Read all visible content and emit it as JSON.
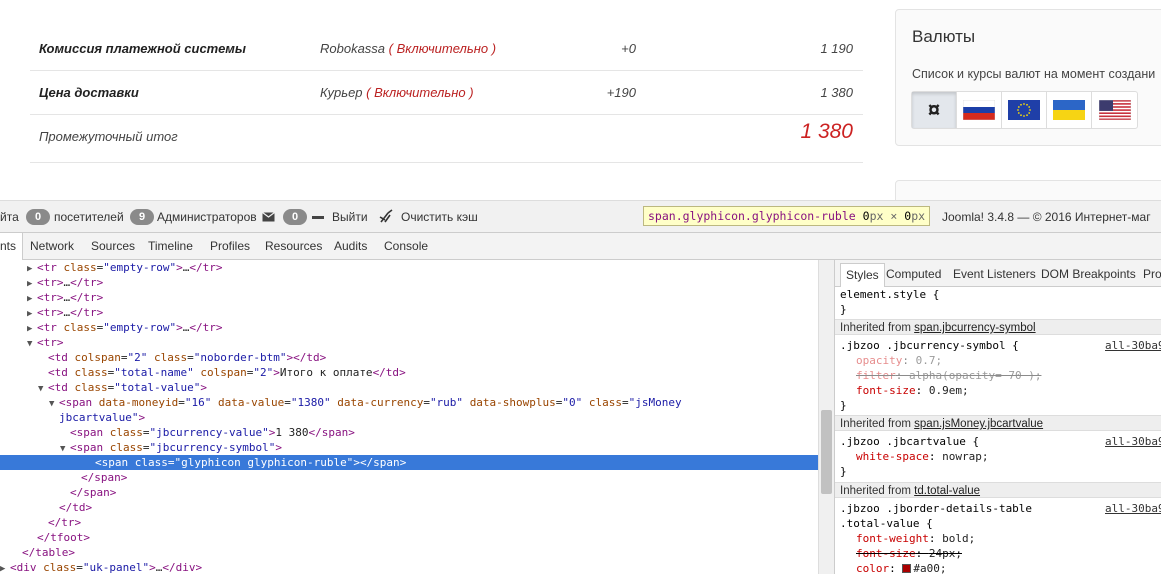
{
  "site": {
    "order_rows": [
      {
        "name": "Комиссия платежной системы",
        "method": "Robokassa",
        "included": "( Включительно )",
        "delta": "+0",
        "total": "1 190"
      },
      {
        "name": "Цена доставки",
        "method": "Курьер",
        "included": "( Включительно )",
        "delta": "+190",
        "total": "1 380"
      }
    ],
    "subtotal": {
      "label": "Промежуточный итог",
      "value": "1 380"
    },
    "currency_panel": {
      "title": "Валюты",
      "description": "Список и курсы валют на момент создани",
      "flags": [
        {
          "name": "generic-currency",
          "icon": "currency-sign-icon",
          "glyph": "¤",
          "active": true
        },
        {
          "name": "russia",
          "icon": "flag-ru-icon",
          "active": false
        },
        {
          "name": "eu",
          "icon": "flag-eu-icon",
          "active": false
        },
        {
          "name": "ukraine",
          "icon": "flag-ua-icon",
          "active": false
        },
        {
          "name": "usa",
          "icon": "flag-us-icon",
          "active": false
        }
      ]
    }
  },
  "admin_bar": {
    "cut_text": "йта",
    "visitors_count": "0",
    "visitors_label": "посетителей",
    "admins_count": "9",
    "admins_label": "Администраторов",
    "messages_count": "0",
    "logout_label": "Выйти",
    "clear_cache_label": "Очистить кэш",
    "version_text": "Joomla! 3.4.8 — © 2016 Интернет-маг"
  },
  "tooltip": {
    "selector": "span.glyphicon.glyphicon-ruble",
    "width": "0",
    "unit1": "px",
    "times": "×",
    "height": "0",
    "unit2": "px"
  },
  "devtools": {
    "tabs": [
      "nts",
      "Network",
      "Sources",
      "Timeline",
      "Profiles",
      "Resources",
      "Audits",
      "Console"
    ],
    "dom": [
      {
        "tri": "▶",
        "html": "<tr class=\"empty-row\">…</tr>"
      },
      {
        "tri": "▶",
        "html": "<tr>…</tr>"
      },
      {
        "tri": "▶",
        "html": "<tr>…</tr>"
      },
      {
        "tri": "▶",
        "html": "<tr>…</tr>"
      },
      {
        "tri": "▶",
        "html": "<tr class=\"empty-row\">…</tr>"
      },
      {
        "tri": "▼",
        "html": "<tr>"
      },
      {
        "tri": "",
        "html": "<td colspan=\"2\" class=\"noborder-btm\"></td>"
      },
      {
        "tri": "",
        "html": "<td class=\"total-name\" colspan=\"2\">Итого к оплате</td>"
      },
      {
        "tri": "▼",
        "html": "<td class=\"total-value\">"
      },
      {
        "tri": "▼",
        "html": "<span data-moneyid=\"16\" data-value=\"1380\" data-currency=\"rub\" data-showplus=\"0\" class=\"jsMoney"
      },
      {
        "tri": "",
        "html": "jbcartvalue\">"
      },
      {
        "tri": "",
        "html": "<span class=\"jbcurrency-value\">1 380</span>"
      },
      {
        "tri": "▼",
        "html": "<span class=\"jbcurrency-symbol\">"
      },
      {
        "tri": "",
        "html": "<span class=\"glyphicon glyphicon-ruble\"></span>"
      },
      {
        "tri": "",
        "html": "</span>"
      },
      {
        "tri": "",
        "html": "</span>"
      },
      {
        "tri": "",
        "html": "</td>"
      },
      {
        "tri": "",
        "html": "</tr>"
      },
      {
        "tri": "",
        "html": "</tfoot>"
      },
      {
        "tri": "",
        "html": "</table>"
      },
      {
        "tri": "▶",
        "html": "<div class=\"uk-panel\">…</div>"
      }
    ],
    "styles_tabs": [
      "Styles",
      "Computed",
      "Event Listeners",
      "DOM Breakpoints",
      "Pro"
    ],
    "styles": {
      "element_style": "element.style {",
      "close": "}",
      "inherited_label": "Inherited from",
      "inh1": "span.jbcurrency-symbol",
      "rule1_sel": ".jbzoo .jbcurrency-symbol {",
      "rule1_src": "all-30ba9",
      "rule1_props": [
        {
          "name": "opacity",
          "value": "0.7;"
        },
        {
          "name": "filter",
          "value": "alpha(opacity= 70 );"
        },
        {
          "name": "font-size",
          "value": "0.9em;"
        }
      ],
      "inh2": "span.jsMoney.jbcartvalue",
      "rule2_sel": ".jbzoo .jbcartvalue {",
      "rule2_src": "all-30ba9",
      "rule2_props": [
        {
          "name": "white-space",
          "value": "nowrap;"
        }
      ],
      "inh3": "td.total-value",
      "rule3_sel1": ".jbzoo .jborder-details-table",
      "rule3_sel2": ".total-value {",
      "rule3_src": "all-30ba9",
      "rule3_props": [
        {
          "name": "font-weight",
          "value": "bold;"
        },
        {
          "name": "font-size",
          "value": "24px;"
        },
        {
          "name": "color",
          "value": "#a00;"
        }
      ],
      "swatch_color": "#aa0000"
    }
  }
}
